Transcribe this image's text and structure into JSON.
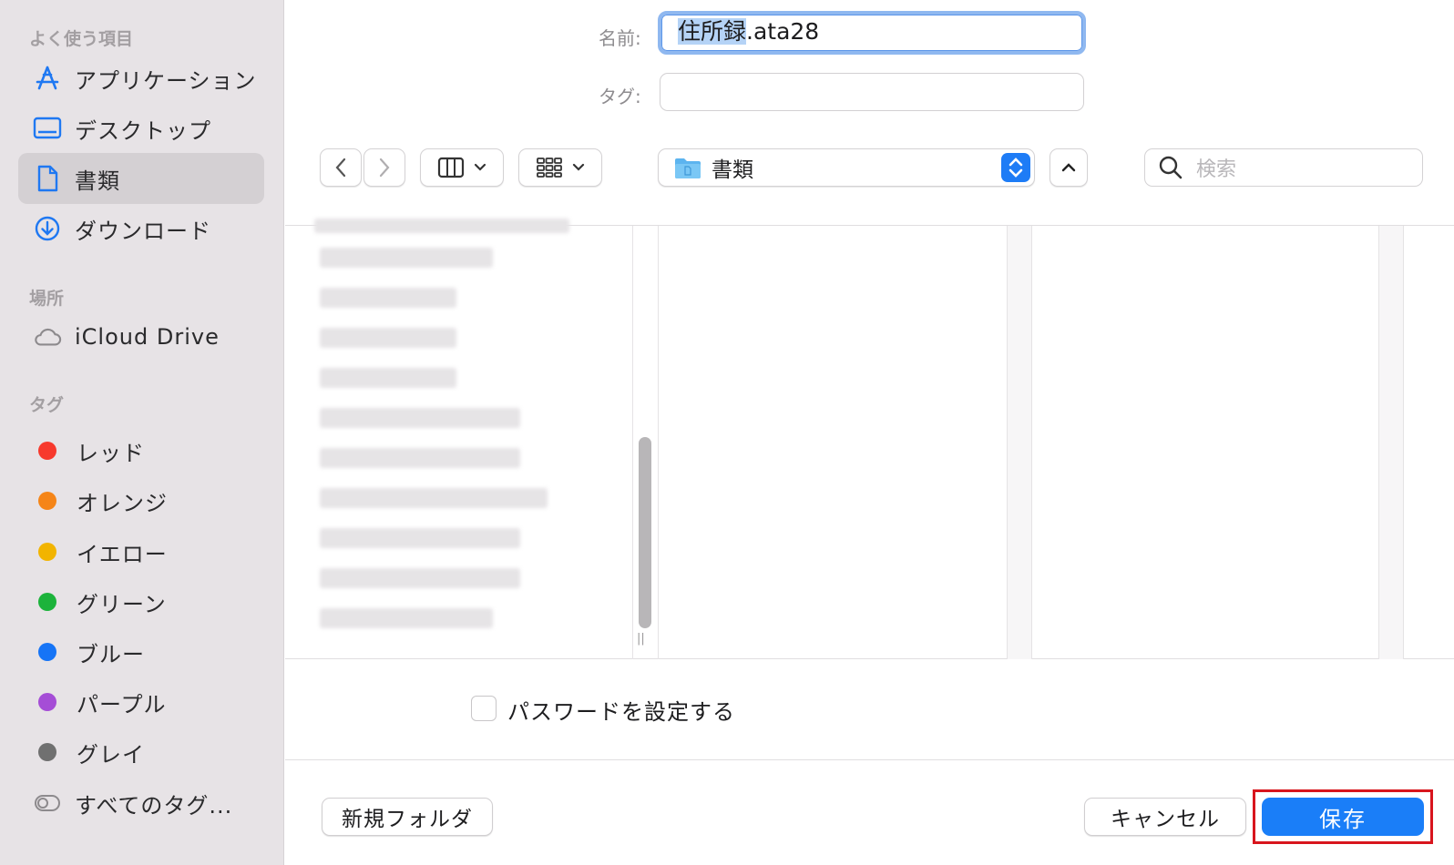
{
  "sidebar": {
    "favorites_heading": "よく使う項目",
    "favorites": [
      {
        "label": "アプリケーション",
        "icon": "app-store-icon"
      },
      {
        "label": "デスクトップ",
        "icon": "desktop-icon"
      },
      {
        "label": "書類",
        "icon": "document-icon",
        "selected": true
      },
      {
        "label": "ダウンロード",
        "icon": "download-icon"
      }
    ],
    "locations_heading": "場所",
    "locations": [
      {
        "label": "iCloud Drive",
        "icon": "cloud-icon"
      }
    ],
    "tags_heading": "タグ",
    "tags": [
      {
        "label": "レッド",
        "color": "#f7392d"
      },
      {
        "label": "オレンジ",
        "color": "#f58518"
      },
      {
        "label": "イエロー",
        "color": "#f2b400"
      },
      {
        "label": "グリーン",
        "color": "#1cb33b"
      },
      {
        "label": "ブルー",
        "color": "#1674f6"
      },
      {
        "label": "パープル",
        "color": "#a54dd6"
      },
      {
        "label": "グレイ",
        "color": "#707070"
      }
    ],
    "all_tags_label": "すべてのタグ..."
  },
  "form": {
    "name_label": "名前:",
    "name_selected": "住所録",
    "name_extension": ".ata28",
    "tag_label": "タグ:",
    "tag_value": ""
  },
  "toolbar": {
    "location": "書類",
    "search_placeholder": "検索"
  },
  "options": {
    "password_label": "パスワードを設定する",
    "password_checked": false
  },
  "footer": {
    "new_folder_label": "新規フォルダ",
    "cancel_label": "キャンセル",
    "save_label": "保存"
  },
  "colors": {
    "accent": "#1a7ef8",
    "highlight_box": "#d8151d"
  }
}
